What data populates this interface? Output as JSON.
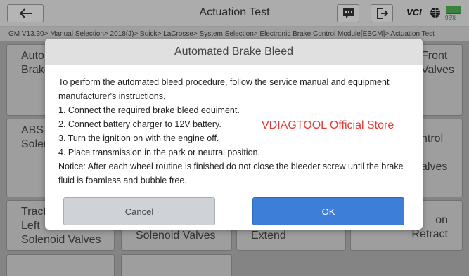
{
  "header": {
    "title": "Actuation Test",
    "vci_label": "VCI",
    "battery_pct": "95%"
  },
  "breadcrumb": "GM V13.30> Manual Selection> 2018(J)> Buick> LaCrosse> System Selection> Electronic Brake Control Module[EBCM]> Actuation Test",
  "tiles": [
    {
      "label": "Auto\nBrake"
    },
    {
      "label": "Front\nValves"
    },
    {
      "label": "ABS\nSolen"
    },
    {
      "label": "ntrol\n\nalves"
    },
    {
      "label": "Tract\nLeft\nSolenoid Valves"
    },
    {
      "label": "Solenoid Valves"
    },
    {
      "label": "Extend"
    },
    {
      "label": "on\nRetract"
    },
    {
      "label": ""
    },
    {
      "label": ""
    }
  ],
  "dialog": {
    "title": "Automated Brake Bleed",
    "lines": [
      "To perform the automated bleed procedure, follow the service manual and equipment manufacturer's instructions.",
      "1. Connect the required brake bleed equiment.",
      "2. Connect battery charger to 12V battery.",
      "3. Turn the ignition on with the engine off.",
      "4. Place transmission in the park or neutral position.",
      "Notice: After each wheel routine is finished do not close the bleeder screw until the brake fluid is foamless and bubble free."
    ],
    "watermark": "VDIAGTOOL Official Store",
    "cancel_label": "Cancel",
    "ok_label": "OK"
  },
  "colors": {
    "ok_button": "#3d7fd8",
    "cancel_button": "#cfd3d8",
    "watermark": "#e53935"
  }
}
